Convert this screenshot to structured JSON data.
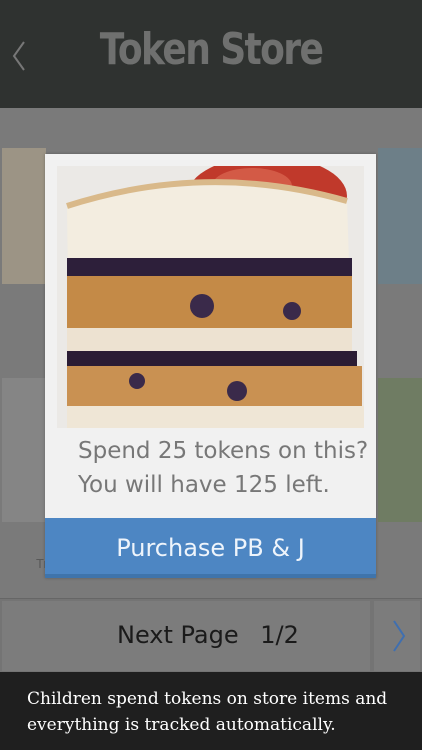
{
  "header": {
    "title": "Token Store",
    "back_icon": "chevron-left-icon"
  },
  "grid": {
    "partial_label": "Tr"
  },
  "modal": {
    "image_subject": "peanut butter and jelly sandwich",
    "prompt_line1": "Spend 25 tokens on this?",
    "prompt_line2": "You will have 125 left.",
    "purchase_label": "Purchase PB & J"
  },
  "nav": {
    "next_label": "Next Page",
    "page": "1/2",
    "next_icon": "chevron-right-icon"
  },
  "footer": {
    "caption": "Children spend tokens on store items and everything is tracked automatically."
  },
  "colors": {
    "header_bg": "#2f3230",
    "title": "#6f706f",
    "purchase_button": "#4d86c3",
    "footer_bg": "#1f1f1f"
  }
}
